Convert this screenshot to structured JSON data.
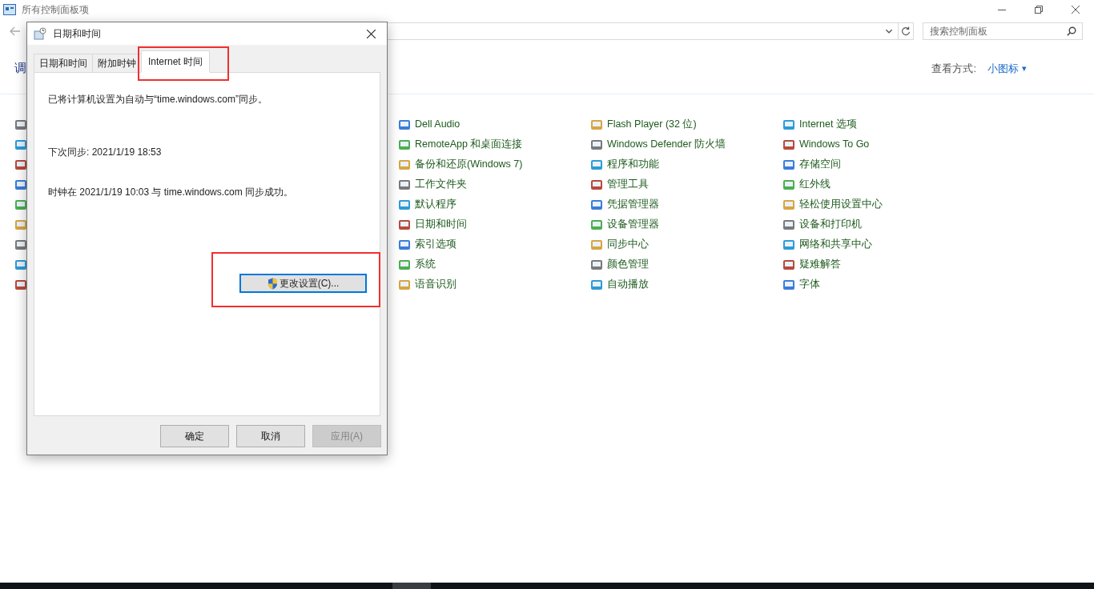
{
  "window": {
    "title": "所有控制面板项"
  },
  "search": {
    "placeholder": "搜索控制面板"
  },
  "heading": "调",
  "view_by": {
    "label": "查看方式:",
    "value": "小图标",
    "caret": "▾"
  },
  "columns": [
    {
      "items": [
        "Dell Audio",
        "RemoteApp 和桌面连接",
        "备份和还原(Windows 7)",
        "工作文件夹",
        "默认程序",
        "日期和时间",
        "索引选项",
        "系统",
        "语音识别"
      ]
    },
    {
      "items": [
        "Flash Player (32 位)",
        "Windows Defender 防火墙",
        "程序和功能",
        "管理工具",
        "凭据管理器",
        "设备管理器",
        "同步中心",
        "颜色管理",
        "自动播放"
      ]
    },
    {
      "items": [
        "Internet 选项",
        "Windows To Go",
        "存储空间",
        "红外线",
        "轻松使用设置中心",
        "设备和打印机",
        "网络和共享中心",
        "疑难解答",
        "字体"
      ]
    }
  ],
  "dialog": {
    "title": "日期和时间",
    "tabs": [
      {
        "label": "日期和时间",
        "selected": false
      },
      {
        "label": "附加时钟",
        "selected": false
      },
      {
        "label": "Internet 时间",
        "selected": true
      }
    ],
    "lines": [
      "已将计算机设置为自动与“time.windows.com”同步。",
      "下次同步: 2021/1/19 18:53",
      "时钟在 2021/1/19 10:03 与 time.windows.com 同步成功。"
    ],
    "change_button": {
      "label": "更改设置(C)...",
      "focused": true
    },
    "buttons": [
      {
        "label": "确定",
        "disabled": false
      },
      {
        "label": "取消",
        "disabled": false
      },
      {
        "label": "应用(A)",
        "disabled": true
      }
    ]
  }
}
